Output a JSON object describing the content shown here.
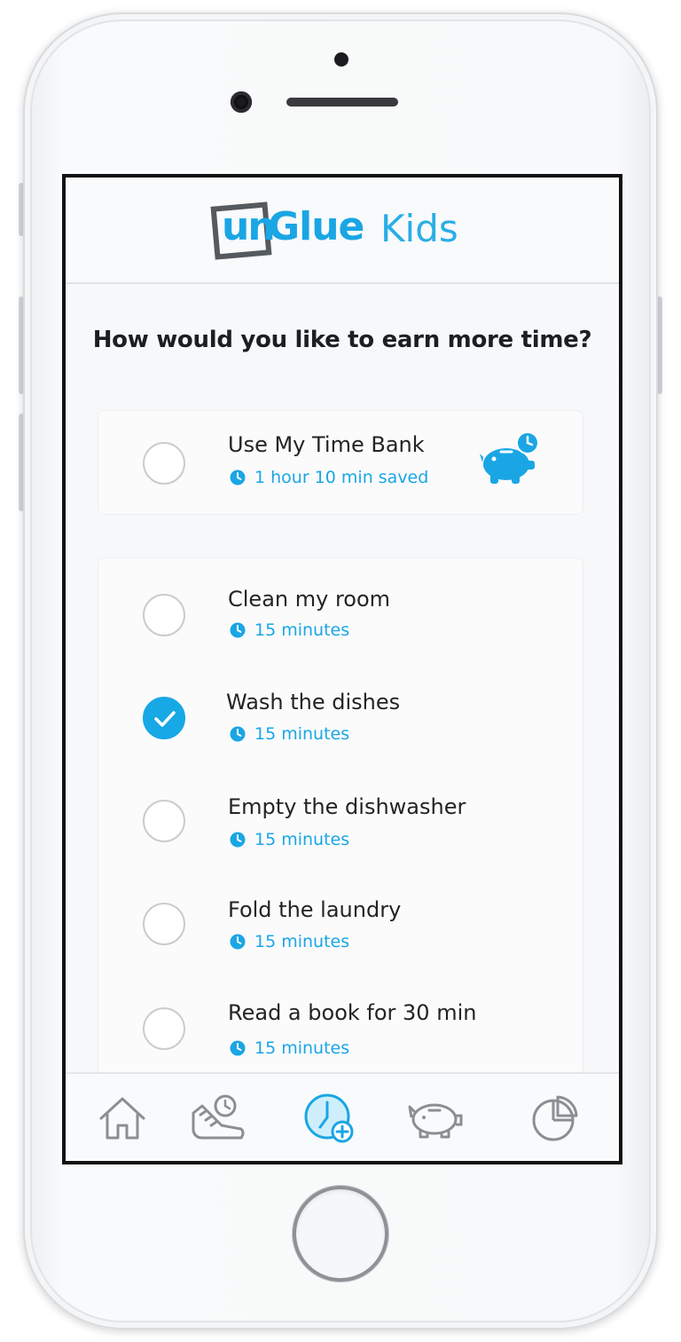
{
  "app": {
    "logo_un": "un",
    "logo_glue": "Glue",
    "logo_kids": "Kids",
    "accent_color": "#1aa6e4"
  },
  "question": "How would you like to earn more time?",
  "time_bank": {
    "title": "Use My Time Bank",
    "saved": "1 hour 10 min saved",
    "selected": false,
    "icon": "piggy-bank-clock-icon"
  },
  "tasks": [
    {
      "title": "Clean my room",
      "duration": "15 minutes",
      "selected": false
    },
    {
      "title": "Wash the dishes",
      "duration": "15 minutes",
      "selected": true
    },
    {
      "title": "Empty the dishwasher",
      "duration": "15 minutes",
      "selected": false
    },
    {
      "title": "Fold the laundry",
      "duration": "15 minutes",
      "selected": false
    },
    {
      "title": "Read a book for 30 min",
      "duration": "15 minutes",
      "selected": false
    }
  ],
  "tab_bar": {
    "items": [
      {
        "icon": "home-icon",
        "active": false
      },
      {
        "icon": "activity-shoe-clock-icon",
        "active": false
      },
      {
        "icon": "earn-time-clock-plus-icon",
        "active": true
      },
      {
        "icon": "piggy-bank-icon",
        "active": false
      },
      {
        "icon": "pie-chart-icon",
        "active": false
      }
    ]
  }
}
